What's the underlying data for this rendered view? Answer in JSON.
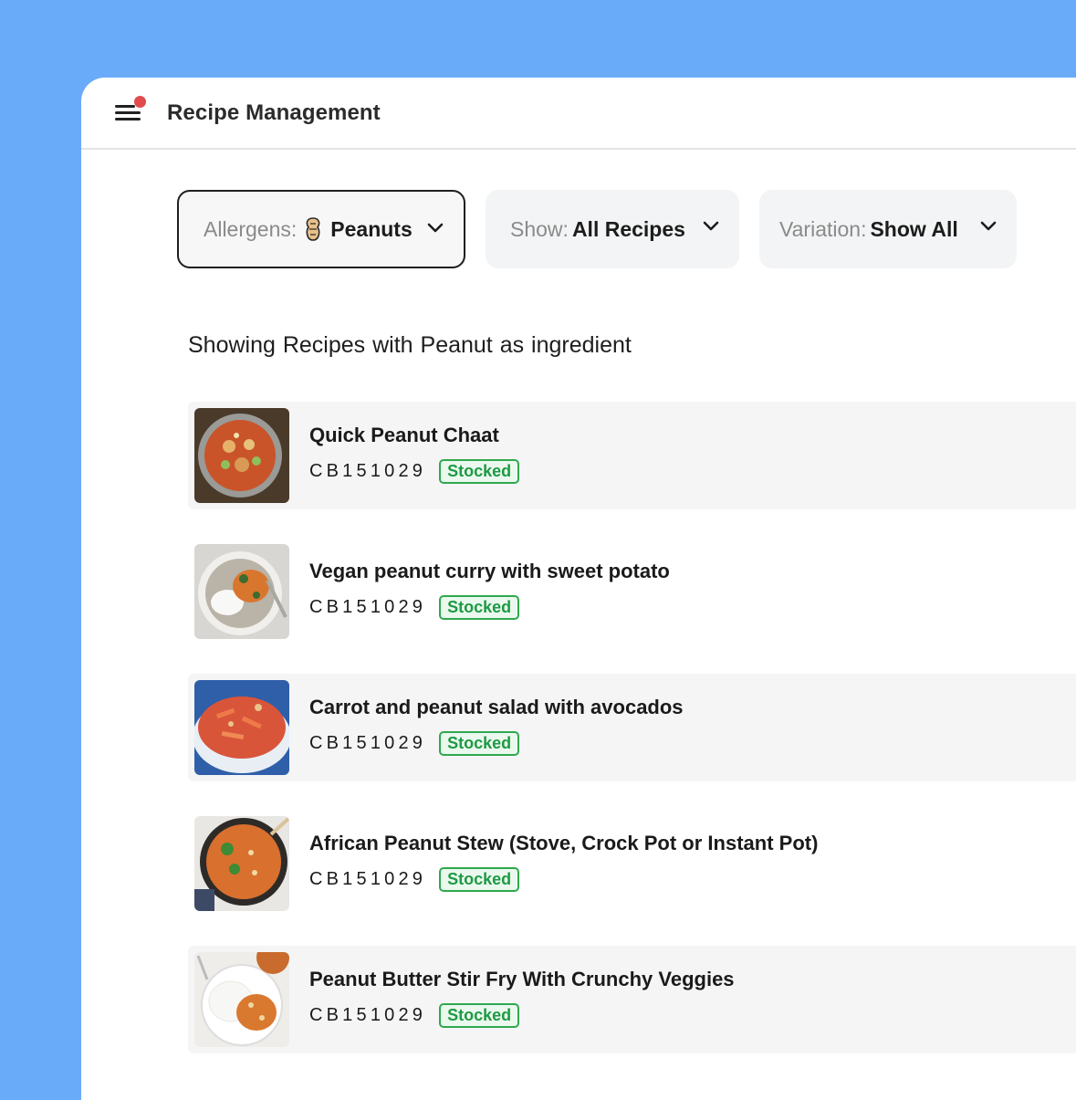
{
  "app": {
    "title": "Recipe Management"
  },
  "filters": {
    "allergens": {
      "label": "Allergens:",
      "value": "Peanuts"
    },
    "show": {
      "label": "Show:",
      "value": "All Recipes"
    },
    "variation": {
      "label": "Variation:",
      "value": "Show All"
    }
  },
  "heading": "Showing  Recipes with Peanut as ingredient",
  "recipes": [
    {
      "title": "Quick Peanut Chaat",
      "code": "CB151029",
      "status": "Stocked"
    },
    {
      "title": "Vegan peanut curry with sweet potato",
      "code": "CB151029",
      "status": "Stocked"
    },
    {
      "title": "Carrot and peanut salad with avocados",
      "code": "CB151029",
      "status": "Stocked"
    },
    {
      "title": "African Peanut Stew (Stove, Crock Pot or Instant Pot)",
      "code": "CB151029",
      "status": "Stocked"
    },
    {
      "title": "Peanut Butter Stir Fry With Crunchy Veggies",
      "code": "CB151029",
      "status": "Stocked"
    }
  ],
  "colors": {
    "background": "#6aabf9",
    "accent_green": "#2fa84f",
    "notification": "#e24b4b"
  },
  "icons": {
    "menu": "hamburger-menu-icon",
    "allergen": "peanut-icon",
    "dropdown": "chevron-down-icon"
  }
}
